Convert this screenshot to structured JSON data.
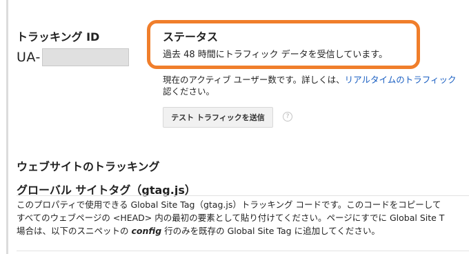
{
  "tracking": {
    "label": "トラッキング ID",
    "ua_prefix": "UA-"
  },
  "status": {
    "title": "ステータス",
    "message": "過去 48 時間にトラフィック データを受信しています。"
  },
  "active_users": {
    "line1_prefix": "現在のアクティブ ユーザー数です。詳しくは、",
    "line1_link": "リアルタイムのトラフィック",
    "line2": "認ください。"
  },
  "test_button": {
    "label": "テスト トラフィックを送信"
  },
  "help_icon": {
    "glyph": "?"
  },
  "website_tracking": {
    "title": "ウェブサイトのトラッキング"
  },
  "gtag": {
    "title": "グローバル サイトタグ（gtag.js）",
    "line1": "このプロパティで使用できる Global Site Tag（gtag.js）トラッキング コードです。このコードをコピーして",
    "line2": "すべてのウェブページの <HEAD> 内の最初の要素として貼り付けてください。ページにすでに Global Site T",
    "line3_prefix": "場合は、以下のスニペットの ",
    "line3_code": "config",
    "line3_suffix": " 行のみを既存の Global Site Tag に追加してください。"
  },
  "colors": {
    "highlight": "#f07e2b",
    "link": "#1a5fc2"
  }
}
